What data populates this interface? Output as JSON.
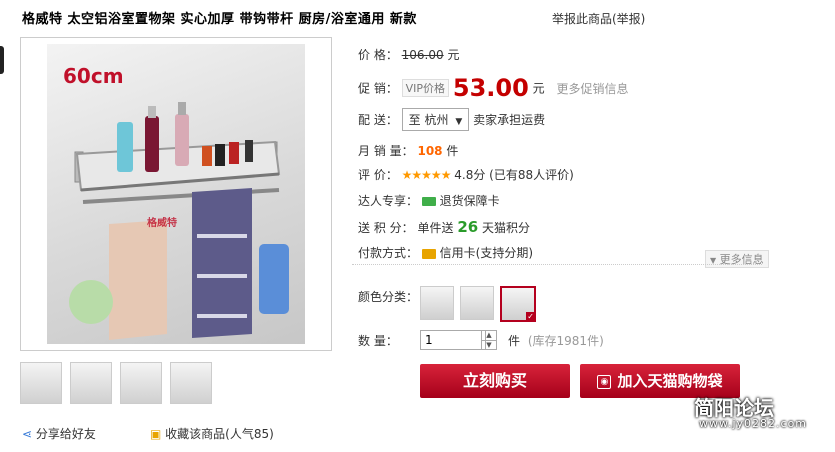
{
  "header": {
    "title": "格威特  太空铝浴室置物架  实心加厚  带钩带杆  厨房/浴室通用  新款",
    "report": "举报此商品(举报)"
  },
  "gallery": {
    "size_label": "60cm",
    "brand_watermark": "格威特"
  },
  "price": {
    "label": "价      格：",
    "original": "106.00",
    "unit": "元"
  },
  "promo": {
    "label": "促      销：",
    "vip_tag": "VIP价格",
    "price": "53.00",
    "unit": "元",
    "more_link": "更多促销信息"
  },
  "delivery": {
    "label": "配      送：",
    "location": "至 杭州",
    "note": "卖家承担运费"
  },
  "sales": {
    "label": "月 销 量：",
    "count": "108",
    "unit": "件"
  },
  "rating": {
    "label": "评      价：",
    "score_text": "4.8分 (已有88人评价)"
  },
  "expert": {
    "label": "达人专享：",
    "value": "退货保障卡"
  },
  "points": {
    "label": "送 积 分：",
    "prefix": "单件送",
    "amount": "26",
    "suffix": "天猫积分"
  },
  "payment": {
    "label": "付款方式：",
    "value": "信用卡(支持分期)",
    "more": "更多信息"
  },
  "color": {
    "label": "颜色分类："
  },
  "quantity": {
    "label": "数      量：",
    "value": "1",
    "unit": "件",
    "stock": "(库存1981件)"
  },
  "buttons": {
    "buy": "立刻购买",
    "cart": "加入天猫购物袋"
  },
  "footer": {
    "share": "分享给好友",
    "favorite": "收藏该商品(人气85)"
  },
  "watermark": {
    "forum": "简阳论坛",
    "url": "www.jy0282.com"
  }
}
